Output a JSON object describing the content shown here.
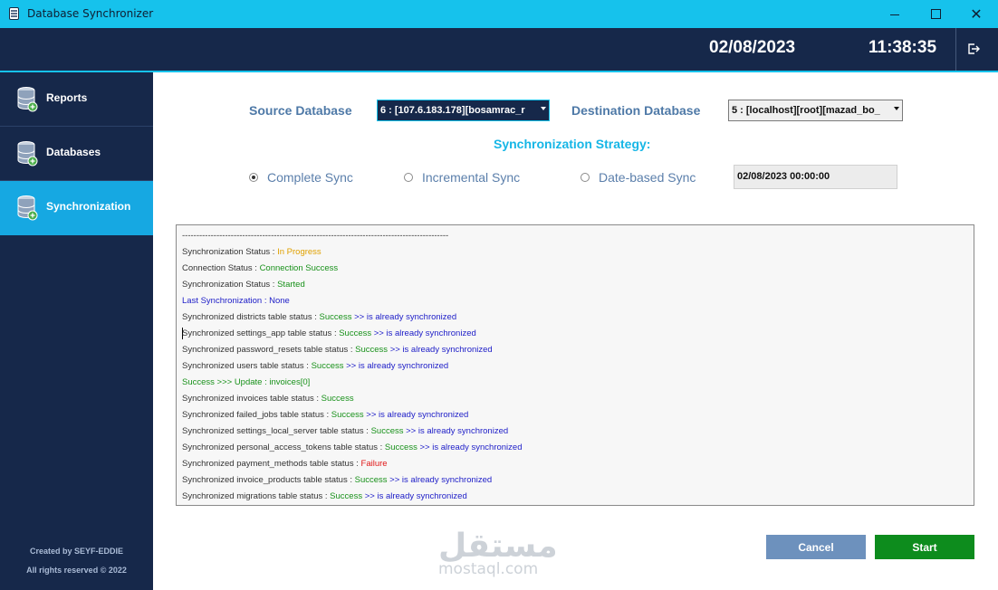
{
  "window": {
    "title": "Database Synchronizer",
    "minimize_icon": "minimize-icon",
    "maximize_icon": "maximize-icon",
    "close_glyph": "✕"
  },
  "header": {
    "date": "02/08/2023",
    "time": "11:38:35",
    "logout_icon": "logout-icon"
  },
  "sidebar": {
    "items": [
      {
        "label": "Reports",
        "icon": "database-add-icon",
        "active": false
      },
      {
        "label": "Databases",
        "icon": "database-add-icon",
        "active": false
      },
      {
        "label": "Synchronization",
        "icon": "database-add-icon",
        "active": true
      }
    ],
    "credit_line1": "Created by SEYF-EDDIE",
    "credit_line2": "All rights reserved © 2022"
  },
  "form": {
    "source_label": "Source Database",
    "source_value": "6 : [107.6.183.178][bosamrac_r",
    "destination_label": "Destination Database",
    "destination_value": "5 : [localhost][root][mazad_bo_",
    "strategy_label": "Synchronization Strategy:",
    "options": [
      {
        "label": "Complete Sync",
        "selected": true
      },
      {
        "label": "Incremental Sync",
        "selected": false
      },
      {
        "label": "Date-based Sync",
        "selected": false
      }
    ],
    "date_value": "02/08/2023 00:00:00"
  },
  "log": {
    "lines": [
      [
        {
          "t": "---------------------------------------------------------------------------------------------",
          "c": "dark"
        }
      ],
      [
        {
          "t": "Synchronization Status : ",
          "c": "dark"
        },
        {
          "t": "In Progress",
          "c": "orange"
        }
      ],
      [
        {
          "t": "Connection Status : ",
          "c": "dark"
        },
        {
          "t": "Connection Success",
          "c": "green"
        }
      ],
      [
        {
          "t": "Synchronization Status : ",
          "c": "dark"
        },
        {
          "t": "Started",
          "c": "green"
        }
      ],
      [
        {
          "t": "Last Synchronization : None",
          "c": "blue"
        }
      ],
      [
        {
          "t": "Synchronized districts table status : ",
          "c": "dark"
        },
        {
          "t": "Success",
          "c": "green"
        },
        {
          "t": "  >> is already synchronized",
          "c": "blue"
        }
      ],
      [
        {
          "t": "Synchronized settings_app table status : ",
          "c": "dark"
        },
        {
          "t": "Success",
          "c": "green"
        },
        {
          "t": "  >> is already synchronized",
          "c": "blue"
        }
      ],
      [
        {
          "t": "Synchronized password_resets table status : ",
          "c": "dark"
        },
        {
          "t": "Success",
          "c": "green"
        },
        {
          "t": "  >> is already synchronized",
          "c": "blue"
        }
      ],
      [
        {
          "t": "Synchronized users table status : ",
          "c": "dark"
        },
        {
          "t": "Success",
          "c": "green"
        },
        {
          "t": "  >> is already synchronized",
          "c": "blue"
        }
      ],
      [
        {
          "t": "Success >>> Update : invoices[0]",
          "c": "green"
        }
      ],
      [
        {
          "t": "Synchronized invoices table status : ",
          "c": "dark"
        },
        {
          "t": "Success",
          "c": "green"
        }
      ],
      [
        {
          "t": "Synchronized failed_jobs table status : ",
          "c": "dark"
        },
        {
          "t": "Success",
          "c": "green"
        },
        {
          "t": "  >> is already synchronized",
          "c": "blue"
        }
      ],
      [
        {
          "t": "Synchronized settings_local_server table status : ",
          "c": "dark"
        },
        {
          "t": "Success",
          "c": "green"
        },
        {
          "t": "  >> is already synchronized",
          "c": "blue"
        }
      ],
      [
        {
          "t": "Synchronized personal_access_tokens table status : ",
          "c": "dark"
        },
        {
          "t": "Success",
          "c": "green"
        },
        {
          "t": "  >> is already synchronized",
          "c": "blue"
        }
      ],
      [
        {
          "t": "Synchronized payment_methods table status : ",
          "c": "dark"
        },
        {
          "t": "Failure",
          "c": "red"
        }
      ],
      [
        {
          "t": "Synchronized invoice_products table status : ",
          "c": "dark"
        },
        {
          "t": "Success",
          "c": "green"
        },
        {
          "t": "  >> is already synchronized",
          "c": "blue"
        }
      ],
      [
        {
          "t": "Synchronized migrations table status : ",
          "c": "dark"
        },
        {
          "t": "Success",
          "c": "green"
        },
        {
          "t": "  >> is already synchronized",
          "c": "blue"
        }
      ]
    ]
  },
  "buttons": {
    "cancel": "Cancel",
    "start": "Start"
  },
  "watermark": {
    "arabic": "مستقل",
    "latin": "mostaql.com"
  }
}
